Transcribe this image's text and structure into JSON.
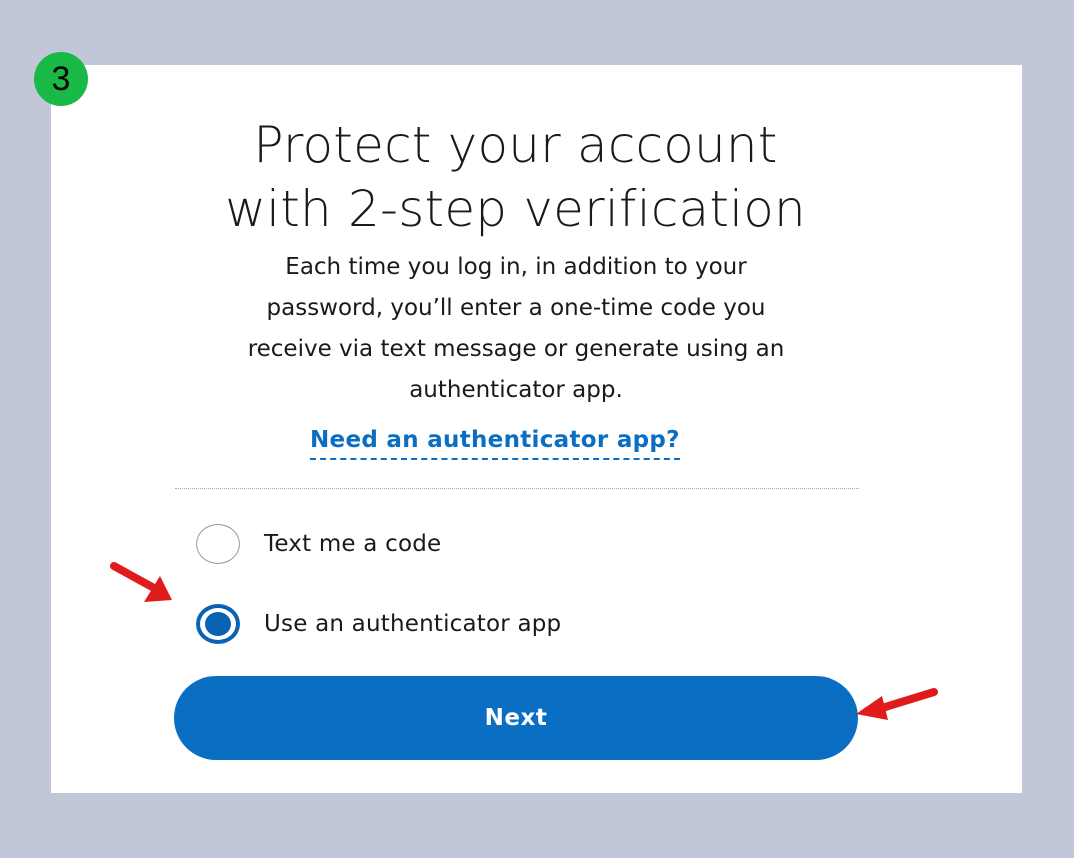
{
  "step_badge": {
    "number": "3",
    "color": "#19b947"
  },
  "heading": {
    "line1": "Protect your account",
    "line2": "with 2-step verification"
  },
  "description": {
    "lines": [
      "Each time you log in, in addition to your",
      "password, you’ll enter a one-time code you",
      "receive via text message or generate using an",
      "authenticator app."
    ]
  },
  "link": {
    "label": "Need an authenticator app?"
  },
  "options": [
    {
      "label": "Text me a code",
      "selected": false
    },
    {
      "label": "Use an authenticator app",
      "selected": true
    }
  ],
  "next_button": {
    "label": "Next"
  },
  "colors": {
    "background": "#c1c7d9",
    "accent": "#0a6fc2",
    "arrow": "#e01b1b"
  },
  "annotations": [
    {
      "icon": "red-arrow-icon",
      "points_to": "Use an authenticator app"
    },
    {
      "icon": "red-arrow-icon",
      "points_to": "Next"
    }
  ]
}
